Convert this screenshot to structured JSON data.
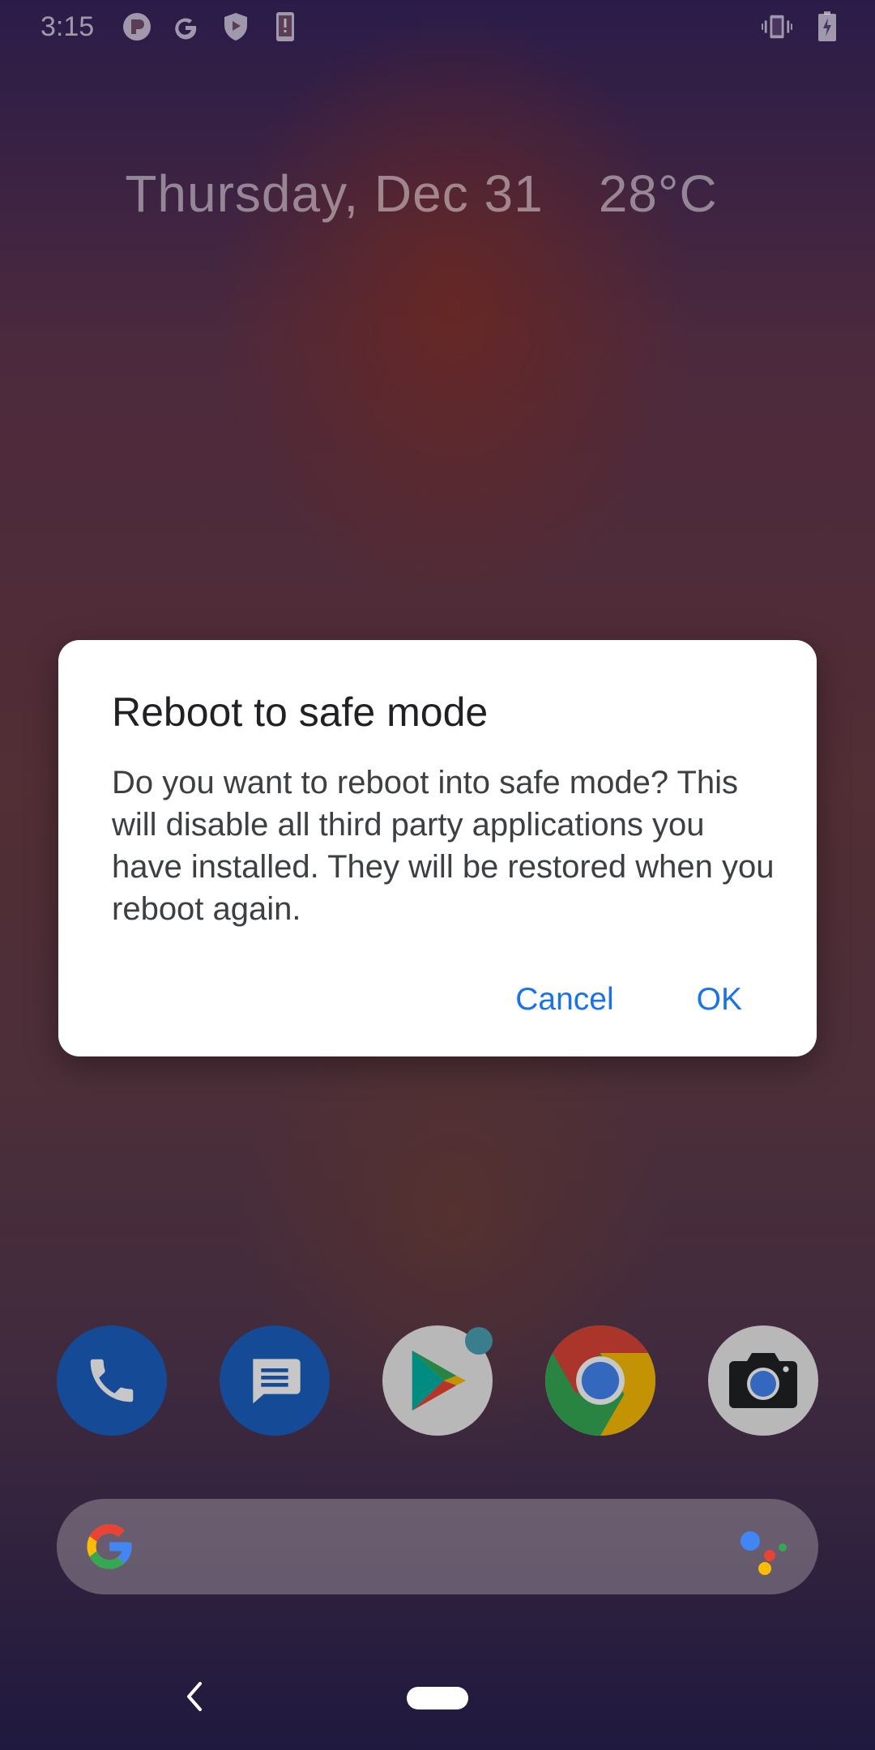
{
  "status_bar": {
    "time": "3:15",
    "left_icons": [
      "ring-icon",
      "google-icon",
      "shield-play-icon",
      "phone-alert-icon"
    ],
    "right_icons": [
      "vibrate-icon",
      "battery-charging-icon"
    ]
  },
  "glance": {
    "date": "Thursday, Dec 31",
    "temperature": "28°C"
  },
  "dialog": {
    "title": "Reboot to safe mode",
    "message": "Do you want to reboot into safe mode? This will disable all third party applications you have installed. They will be restored when you reboot again.",
    "cancel_label": "Cancel",
    "ok_label": "OK",
    "accent_color": "#1a73e8"
  },
  "dock": {
    "apps": [
      {
        "name": "phone",
        "icon": "phone-icon",
        "color": "#1a5fc0"
      },
      {
        "name": "messages",
        "icon": "message-icon",
        "color": "#1a5fc0"
      },
      {
        "name": "play-store",
        "icon": "play-store-icon",
        "color": "#e8e8e8",
        "has_badge": true
      },
      {
        "name": "chrome",
        "icon": "chrome-icon",
        "color": "#db4437"
      },
      {
        "name": "camera",
        "icon": "camera-icon",
        "color": "#e8e8e8"
      }
    ]
  },
  "search_bar": {
    "left_icon": "google-g-icon",
    "right_icon": "assistant-icon"
  },
  "nav_bar": {
    "buttons": [
      "back-icon",
      "home-pill"
    ]
  }
}
